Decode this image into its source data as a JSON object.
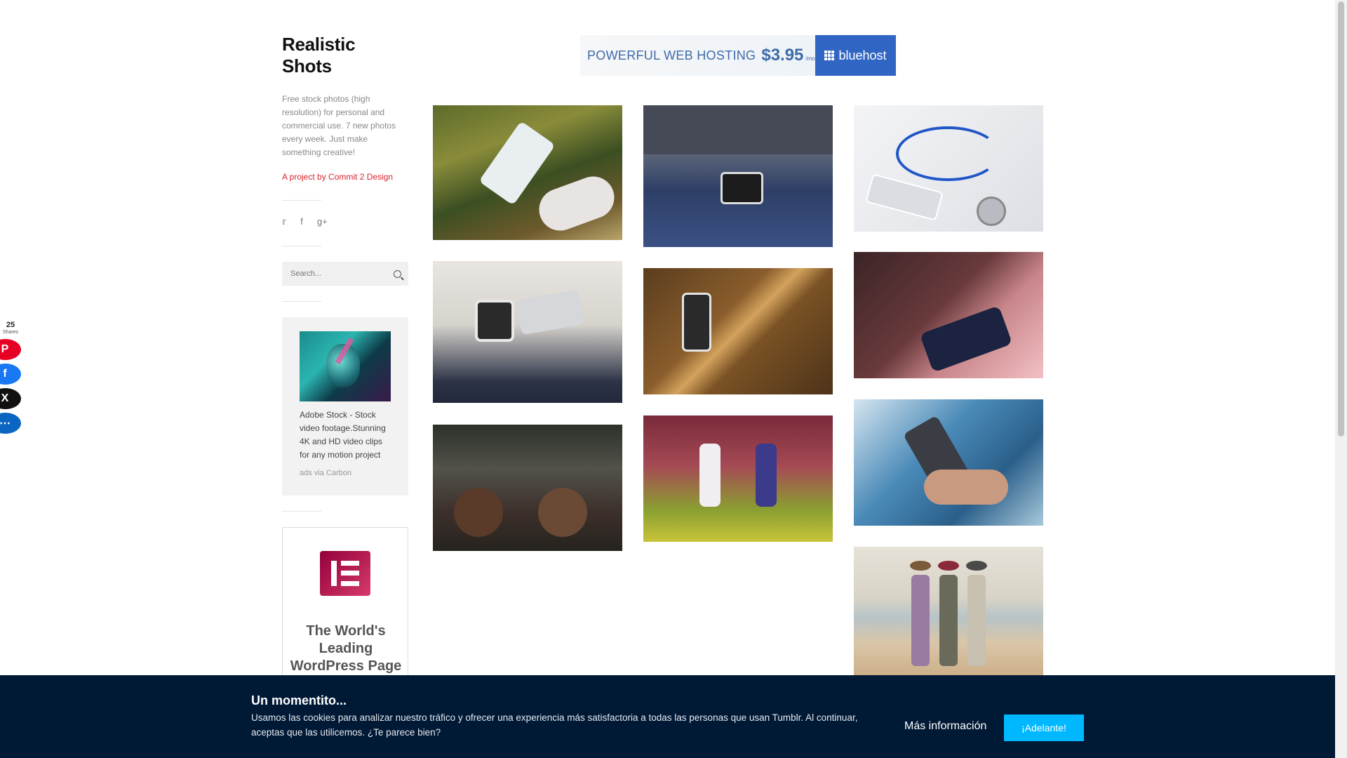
{
  "site": {
    "title": "Realistic Shots",
    "description": "Free stock photos (high resolution) for personal and commercial use. 7 new photos every week. Just make something creative!",
    "credit": "A project by Commit 2 Design",
    "socials": [
      "twitter-icon",
      "facebook-icon",
      "google-plus-icon"
    ],
    "search_placeholder": "Search..."
  },
  "share": {
    "count": "25",
    "label": "Shares",
    "pinterest_count": "25",
    "buttons": [
      "pinterest-icon",
      "facebook-icon",
      "x-icon",
      "sharethis-icon"
    ]
  },
  "carbon_ad": {
    "text": "Adobe Stock - Stock video footage.Stunning 4K and HD video clips for any motion project",
    "via": "ads via Carbon"
  },
  "elementor_ad": {
    "headline": "The World's Leading WordPress Page Builder"
  },
  "banner": {
    "text": "POWERFUL WEB HOSTING",
    "price": "$3.95",
    "unit": "/mo",
    "brand": "bluehost"
  },
  "photos": [
    {
      "name": "photo-phone-on-grass"
    },
    {
      "name": "photo-phone-on-jeans"
    },
    {
      "name": "photo-stethoscope-phone"
    },
    {
      "name": "photo-watch-and-phone"
    },
    {
      "name": "photo-phone-on-wood"
    },
    {
      "name": "photo-phone-on-notebook"
    },
    {
      "name": "photo-girls-on-truck"
    },
    {
      "name": "photo-girls-in-field"
    },
    {
      "name": "photo-hand-holding-phone"
    },
    {
      "name": "photo-girls-on-beach"
    }
  ],
  "cookie": {
    "title": "Un momentito...",
    "text": "Usamos las cookies para analizar nuestro tráfico y ofrecer una experiencia más satisfactoria a todas las personas que usan Tumblr. Al continuar, aceptas que las utilicemos. ¿Te parece bien?",
    "more_label": "Más información",
    "accept_label": "¡Adelante!"
  },
  "colors": {
    "credit": "#d9232d",
    "cookie_bg": "#001935",
    "accept_button": "#00b8ff",
    "bluehost": "#3165c4"
  }
}
